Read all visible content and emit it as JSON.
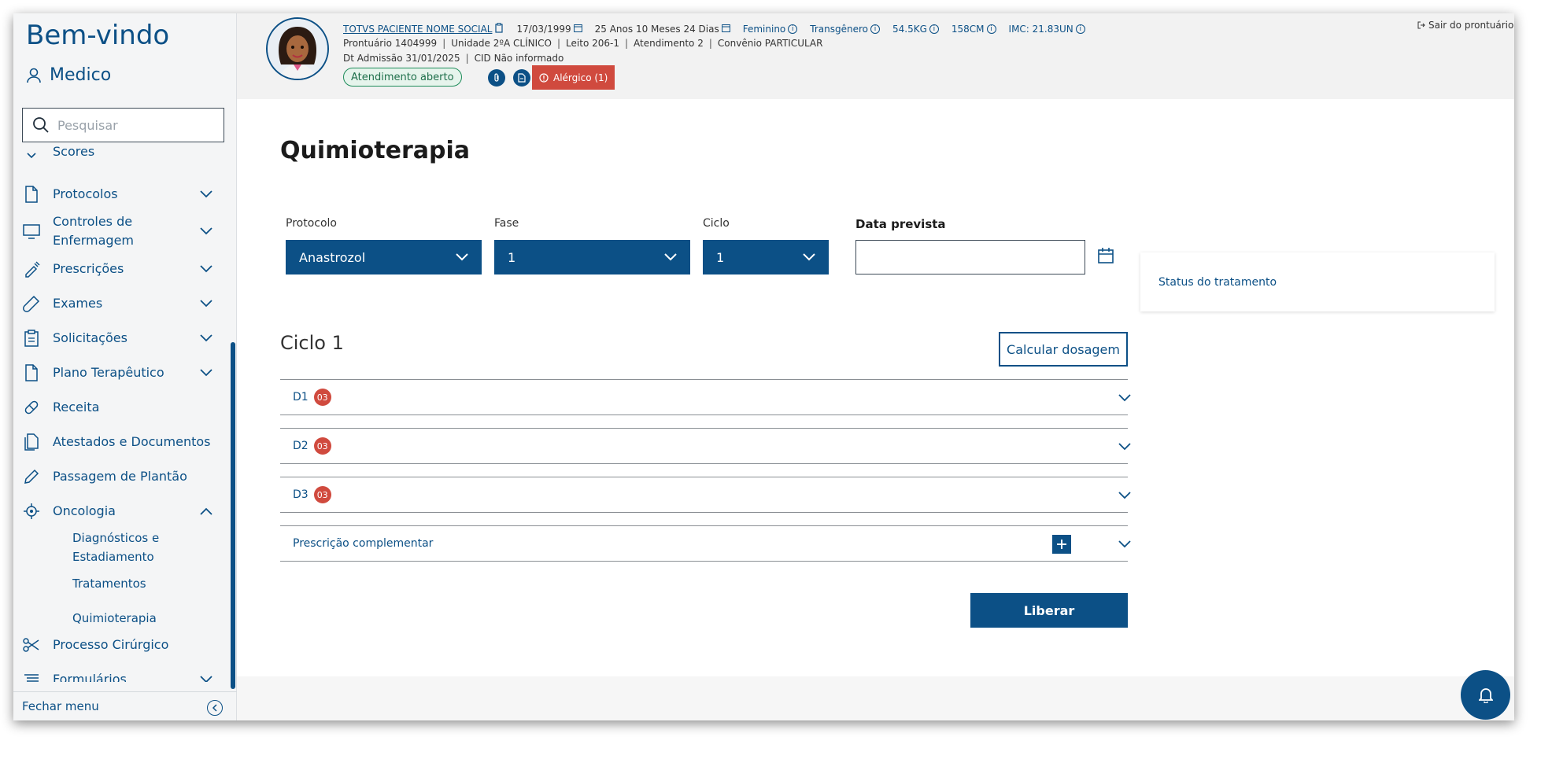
{
  "colors": {
    "primary": "#0c5086",
    "danger": "#d04a3e",
    "success": "#1e8c5a"
  },
  "sidebar": {
    "welcome": "Bem-vindo",
    "user_role": "Medico",
    "search_placeholder": "Pesquisar",
    "partial_item": "Scores",
    "items": [
      {
        "label": "Protocolos",
        "icon": "document-icon"
      },
      {
        "label": "Controles de Enfermagem",
        "icon": "monitor-icon"
      },
      {
        "label": "Prescrições",
        "icon": "syringe-icon"
      },
      {
        "label": "Exames",
        "icon": "test-tube-icon"
      },
      {
        "label": "Solicitações",
        "icon": "clipboard-icon"
      },
      {
        "label": "Plano Terapêutico",
        "icon": "document-icon"
      },
      {
        "label": "Receita",
        "icon": "pill-icon"
      },
      {
        "label": "Atestados e Documentos",
        "icon": "documents-icon"
      },
      {
        "label": "Passagem de Plantão",
        "icon": "pencil-icon"
      },
      {
        "label": "Oncologia",
        "icon": "cell-icon"
      },
      {
        "label": "Processo Cirúrgico",
        "icon": "scissors-icon"
      },
      {
        "label": "Formulários",
        "icon": "list-icon"
      }
    ],
    "oncologia_sub": [
      "Diagnósticos e Estadiamento",
      "Tratamentos",
      "Quimioterapia"
    ],
    "close_menu": "Fechar menu"
  },
  "header": {
    "patient_name": "TOTVS PACIENTE NOME SOCIAL",
    "birth_date": "17/03/1999",
    "age": "25 Anos 10 Meses 24 Dias",
    "gender": "Feminino",
    "identity": "Transgênero",
    "weight": "54.5KG",
    "height": "158CM",
    "bmi": "IMC: 21.83UN",
    "prontuario": "Prontuário 1404999",
    "unidade": "Unidade 2ºA CLÍNICO",
    "leito": "Leito 206-1",
    "atendimento": "Atendimento 2",
    "convenio": "Convênio PARTICULAR",
    "admissao": "Dt Admissão 31/01/2025",
    "cid": "CID Não informado",
    "status_chip": "Atendimento aberto",
    "allergy": "Alérgico (1)",
    "exit": "Sair do prontuário"
  },
  "main": {
    "title": "Quimioterapia",
    "protocol_label": "Protocolo",
    "protocol_value": "Anastrozol",
    "phase_label": "Fase",
    "phase_value": "1",
    "cycle_label": "Ciclo",
    "cycle_value": "1",
    "date_label": "Data prevista",
    "date_value": "",
    "status_card": "Status do tratamento",
    "cycle_title": "Ciclo 1",
    "calc_button": "Calcular dosagem",
    "days": [
      {
        "label": "D1",
        "badge": "03"
      },
      {
        "label": "D2",
        "badge": "03"
      },
      {
        "label": "D3",
        "badge": "03"
      }
    ],
    "complementary": "Prescrição complementar",
    "release_button": "Liberar"
  }
}
